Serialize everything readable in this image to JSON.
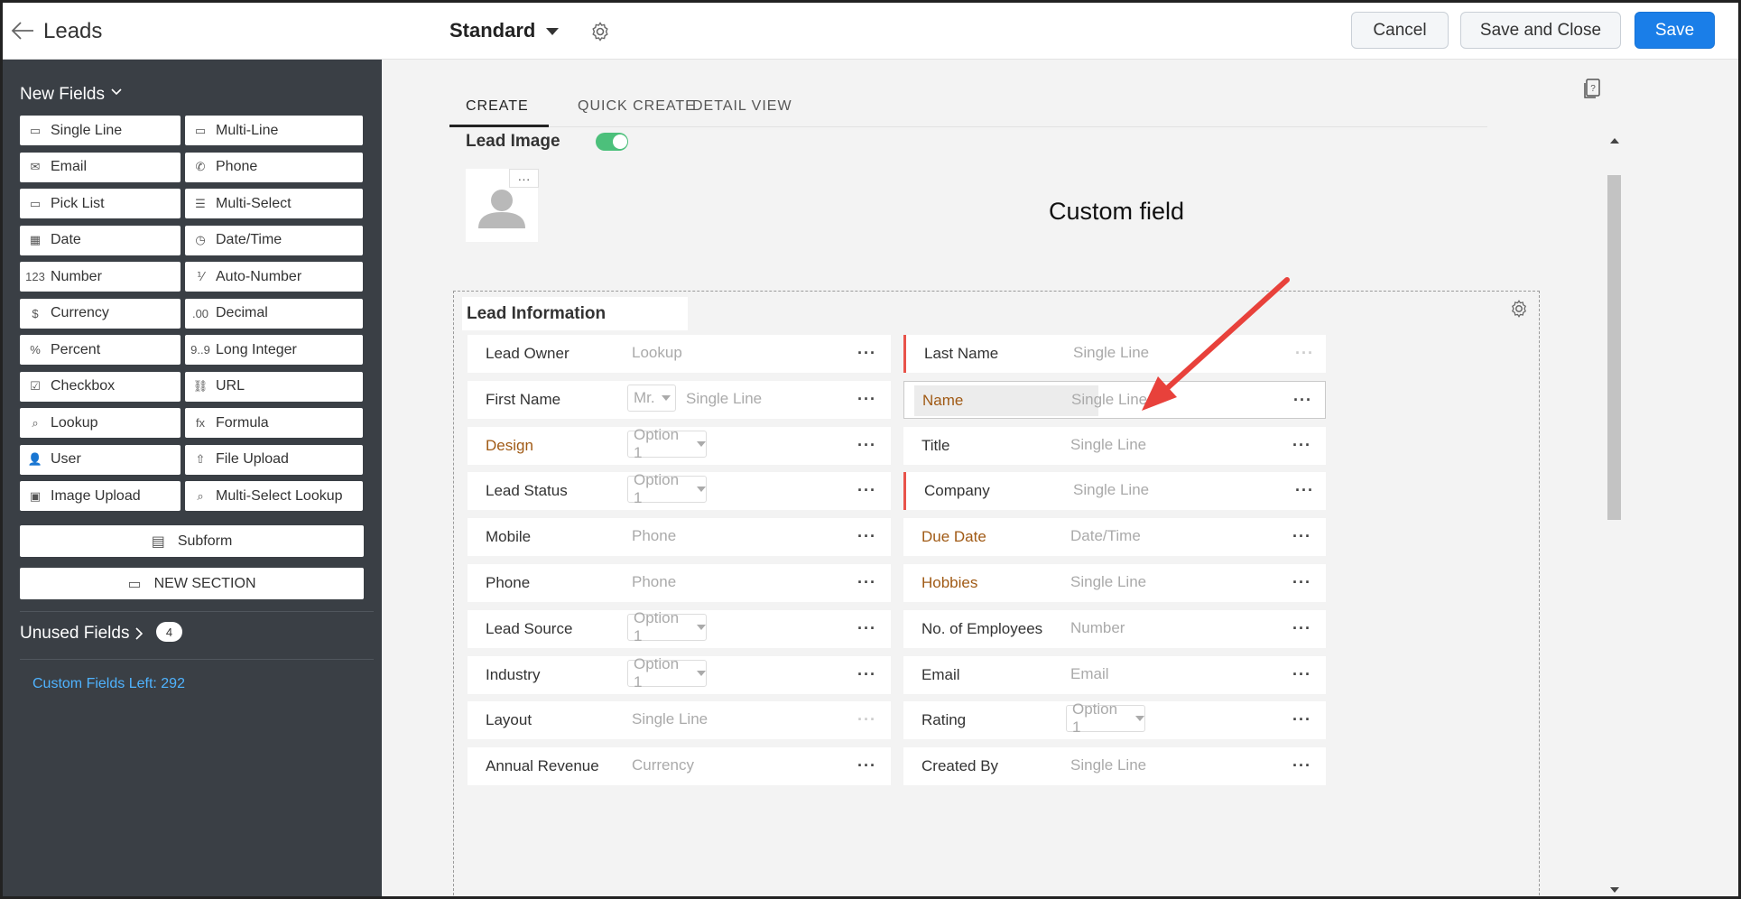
{
  "header": {
    "module_title": "Leads",
    "layout_name": "Standard",
    "cancel_label": "Cancel",
    "save_close_label": "Save and Close",
    "save_label": "Save"
  },
  "colors": {
    "primary": "#1a7ee8",
    "sidebar_bg": "#3a3f45",
    "required": "#e8534a",
    "custom_label": "#a05a15",
    "toggle_on": "#4cc07b",
    "link": "#4fb3ff"
  },
  "sidebar": {
    "new_fields_label": "New Fields",
    "palette": [
      {
        "label": "Single Line",
        "icon": "single-line-icon"
      },
      {
        "label": "Multi-Line",
        "icon": "multi-line-icon"
      },
      {
        "label": "Email",
        "icon": "email-icon"
      },
      {
        "label": "Phone",
        "icon": "phone-icon"
      },
      {
        "label": "Pick List",
        "icon": "pick-list-icon"
      },
      {
        "label": "Multi-Select",
        "icon": "multi-select-icon"
      },
      {
        "label": "Date",
        "icon": "date-icon"
      },
      {
        "label": "Date/Time",
        "icon": "date-time-icon"
      },
      {
        "label": "Number",
        "icon": "number-icon"
      },
      {
        "label": "Auto-Number",
        "icon": "auto-number-icon"
      },
      {
        "label": "Currency",
        "icon": "currency-icon"
      },
      {
        "label": "Decimal",
        "icon": "decimal-icon"
      },
      {
        "label": "Percent",
        "icon": "percent-icon"
      },
      {
        "label": "Long Integer",
        "icon": "long-integer-icon"
      },
      {
        "label": "Checkbox",
        "icon": "checkbox-icon"
      },
      {
        "label": "URL",
        "icon": "url-icon"
      },
      {
        "label": "Lookup",
        "icon": "lookup-icon"
      },
      {
        "label": "Formula",
        "icon": "formula-icon"
      },
      {
        "label": "User",
        "icon": "user-icon"
      },
      {
        "label": "File Upload",
        "icon": "file-upload-icon"
      },
      {
        "label": "Image Upload",
        "icon": "image-upload-icon"
      },
      {
        "label": "Multi-Select Lookup",
        "icon": "multi-select-lookup-icon"
      }
    ],
    "icon_glyphs": [
      "▭",
      "▭",
      "✉",
      "✆",
      "▭",
      "☰",
      "▦",
      "◷",
      "123",
      "⅟",
      "$",
      ".00",
      "%",
      "9..9",
      "☑",
      "⛓",
      "⌕",
      "fx",
      "👤",
      "⇧",
      "▣",
      "⌕"
    ],
    "subform_label": "Subform",
    "new_section_label": "NEW SECTION",
    "unused_fields_label": "Unused Fields",
    "unused_count": "4",
    "custom_fields_left": "Custom Fields Left: 292"
  },
  "tabs": [
    "CREATE",
    "QUICK CREATE",
    "DETAIL VIEW"
  ],
  "lead_image": {
    "label": "Lead Image",
    "enabled": true
  },
  "section": {
    "title": "Lead Information",
    "left_fields": [
      {
        "label": "Lead Owner",
        "type": "Lookup"
      },
      {
        "label": "First Name",
        "salutation": "Mr.",
        "type": "Single Line"
      },
      {
        "label": "Design",
        "select": "Option 1",
        "custom": true
      },
      {
        "label": "Lead Status",
        "select": "Option 1"
      },
      {
        "label": "Mobile",
        "type": "Phone"
      },
      {
        "label": "Phone",
        "type": "Phone"
      },
      {
        "label": "Lead Source",
        "select": "Option 1"
      },
      {
        "label": "Industry",
        "select": "Option 1"
      },
      {
        "label": "Layout",
        "type": "Single Line"
      },
      {
        "label": "Annual Revenue",
        "type": "Currency"
      }
    ],
    "right_fields": [
      {
        "label": "Last Name",
        "type": "Single Line",
        "required": true
      },
      {
        "label": "Name",
        "type": "Single Line",
        "custom": true,
        "selected": true
      },
      {
        "label": "Title",
        "type": "Single Line"
      },
      {
        "label": "Company",
        "type": "Single Line",
        "required": true
      },
      {
        "label": "Due Date",
        "type": "Date/Time",
        "custom": true
      },
      {
        "label": "Hobbies",
        "type": "Single Line",
        "custom": true
      },
      {
        "label": "No. of Employees",
        "type": "Number"
      },
      {
        "label": "Email",
        "type": "Email"
      },
      {
        "label": "Rating",
        "select": "Option 1"
      },
      {
        "label": "Created By",
        "type": "Single Line"
      }
    ],
    "more_label": "···"
  },
  "annotation": {
    "text": "Custom field"
  }
}
